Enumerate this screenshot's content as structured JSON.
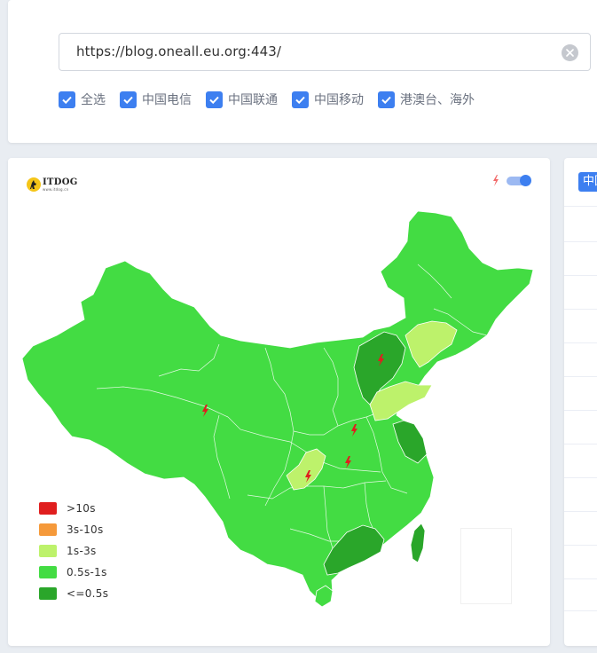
{
  "url_bar": {
    "value": "https://blog.oneall.eu.org:443/",
    "clear_icon": "clear-circle-icon"
  },
  "filters": [
    {
      "label": "全选",
      "checked": true
    },
    {
      "label": "中国电信",
      "checked": true
    },
    {
      "label": "中国联通",
      "checked": true
    },
    {
      "label": "中国移动",
      "checked": true
    },
    {
      "label": "港澳台、海外",
      "checked": true
    }
  ],
  "map_panel": {
    "logo_text": "ITDOG",
    "logo_sub": "www.itdog.cn",
    "toggle_icon": "lightning-icon",
    "toggle_on": true
  },
  "legend": [
    {
      "label": ">10s",
      "color": "#e01e1e"
    },
    {
      "label": "3s-10s",
      "color": "#f5993a"
    },
    {
      "label": "1s-3s",
      "color": "#bdf26b"
    },
    {
      "label": "0.5s-1s",
      "color": "#43dc43"
    },
    {
      "label": "<=0.5s",
      "color": "#2aa62a"
    }
  ],
  "map_colors": {
    "fast": "#2aa62a",
    "normal": "#43dc43",
    "slow": "#bdf26b",
    "border": "#ffffff",
    "marker": "#e01e1e"
  },
  "right_panel": {
    "tag_label": "中国"
  }
}
